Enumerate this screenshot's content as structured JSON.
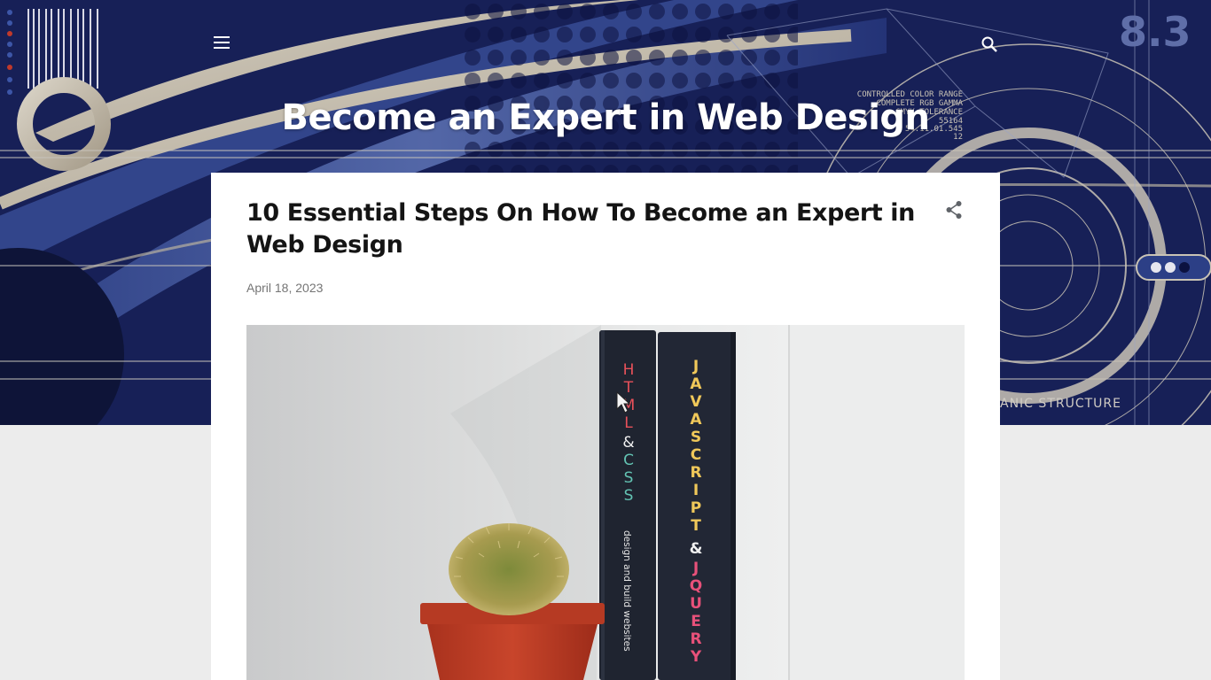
{
  "header": {
    "blog_title": "Become an Expert in Web Design",
    "menu_icon": "hamburger-menu-icon",
    "search_icon": "search-icon",
    "decor_text": {
      "line1": "CONTROLLED COLOR RANGE",
      "line2": "COMPLETE RGB GAMMA",
      "line3": "CMYK TOLERANCE",
      "line4": "55164",
      "line5": "54.11.01.545",
      "line6": "12",
      "corner_number": "8.3",
      "structure_label": "ANIC STRUCTURE"
    }
  },
  "post": {
    "title": "10 Essential Steps On How To Become an Expert in Web Design",
    "date": "April 18, 2023",
    "share_icon": "share-icon",
    "image": {
      "book1_spine_top": "HTML",
      "book1_spine_amp": "&",
      "book1_spine_css": "CSS",
      "book1_subtitle": "design and build websites",
      "book2_spine_top": "JAVASCRIPT",
      "book2_spine_amp": "&",
      "book2_spine_bottom": "JQUERY"
    }
  },
  "colors": {
    "header_bg": "#141b4d",
    "page_bg": "#ececec",
    "card_bg": "#ffffff",
    "title_text": "#141414",
    "date_text": "#757575"
  }
}
